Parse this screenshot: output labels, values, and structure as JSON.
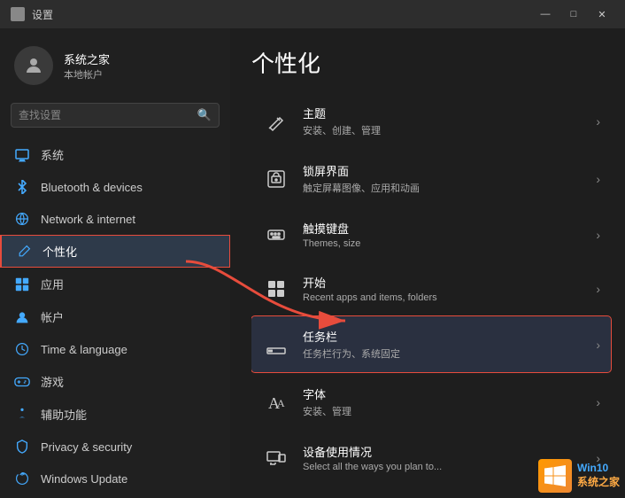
{
  "window": {
    "title": "设置",
    "controls": {
      "minimize": "—",
      "maximize": "□",
      "close": "✕"
    }
  },
  "sidebar": {
    "user": {
      "name": "系统之家",
      "type": "本地帐户"
    },
    "search": {
      "placeholder": "查找设置"
    },
    "nav_items": [
      {
        "id": "system",
        "label": "系统",
        "icon": "🖥"
      },
      {
        "id": "bluetooth",
        "label": "Bluetooth & devices",
        "icon": "🔵"
      },
      {
        "id": "network",
        "label": "Network & internet",
        "icon": "🌐"
      },
      {
        "id": "personalization",
        "label": "个性化",
        "icon": "✏️",
        "active": true
      },
      {
        "id": "apps",
        "label": "应用",
        "icon": "📦"
      },
      {
        "id": "accounts",
        "label": "帐户",
        "icon": "👤"
      },
      {
        "id": "time",
        "label": "Time & language",
        "icon": "🕐"
      },
      {
        "id": "gaming",
        "label": "游戏",
        "icon": "🎮"
      },
      {
        "id": "accessibility",
        "label": "辅助功能",
        "icon": "♿"
      },
      {
        "id": "privacy",
        "label": "Privacy & security",
        "icon": "🔒"
      },
      {
        "id": "update",
        "label": "Windows Update",
        "icon": "🔄"
      }
    ]
  },
  "main": {
    "title": "个性化",
    "items": [
      {
        "id": "themes",
        "title": "主题",
        "desc": "安装、创建、管理",
        "icon": "theme"
      },
      {
        "id": "lockscreen",
        "title": "锁屏界面",
        "desc": "触定屏幕图像、应用和动画",
        "icon": "lock"
      },
      {
        "id": "touchkb",
        "title": "触摸键盘",
        "desc": "Themes, size",
        "icon": "keyboard"
      },
      {
        "id": "start",
        "title": "开始",
        "desc": "Recent apps and items, folders",
        "icon": "start"
      },
      {
        "id": "taskbar",
        "title": "任务栏",
        "desc": "任务栏行为、系统固定",
        "icon": "taskbar",
        "highlighted": true
      },
      {
        "id": "fonts",
        "title": "字体",
        "desc": "安装、管理",
        "icon": "font"
      },
      {
        "id": "deviceusage",
        "title": "设备使用情况",
        "desc": "Select all the ways you plan to...",
        "icon": "device"
      }
    ]
  },
  "watermark": {
    "logo": "⊞",
    "line1": "Win10",
    "line2": "系统之家"
  }
}
